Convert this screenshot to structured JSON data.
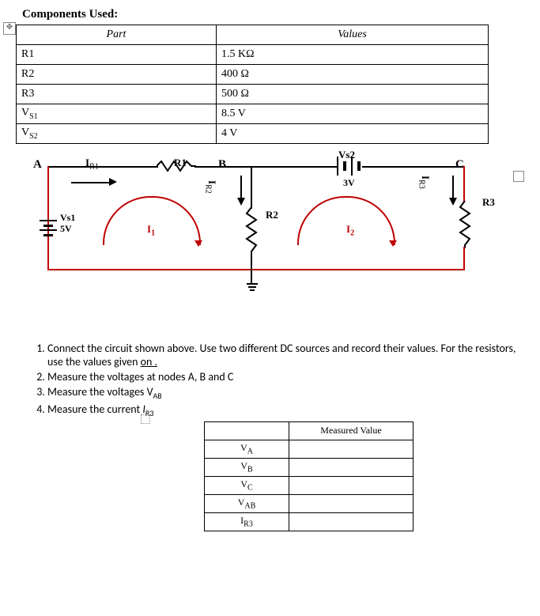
{
  "title": "Components Used:",
  "componentsTable": {
    "headers": {
      "part": "Part",
      "values": "Values"
    },
    "rows": [
      {
        "part": "R1",
        "value": "1.5 KΩ"
      },
      {
        "part": "R2",
        "value": "400 Ω"
      },
      {
        "part": "R3",
        "value": "500 Ω"
      },
      {
        "part": "Vs1",
        "partPrefix": "V",
        "partSub": "S1",
        "value": "8.5 V"
      },
      {
        "part": "Vs2",
        "partPrefix": "V",
        "partSub": "S2",
        "value": "4 V"
      }
    ]
  },
  "circuit": {
    "nodes": {
      "A": "A",
      "B": "B",
      "C": "C"
    },
    "labels": {
      "IR1": "I",
      "IR1sub": "R1",
      "R1": "R1",
      "IR2": "I",
      "IR2sub": "R2",
      "R2": "R2",
      "Vs2": "Vs2",
      "Vs2val": "3V",
      "IR3": "I",
      "IR3sub": "R3",
      "R3": "R3",
      "Vs1line1": "Vs1",
      "Vs1line2": "5V",
      "I1": "I",
      "I1sub": "1",
      "I2": "I",
      "I2sub": "2"
    }
  },
  "instructions": {
    "item1a": "Connect the circuit shown above. Use two different DC sources and record their values. For the resistors, use the values given ",
    "item1link": "on .",
    "item2": "Measure the voltages at nodes A, B and C",
    "item3a": "Measure the voltages V",
    "item3sub": "AB",
    "item4a": "Measure the current ",
    "item4cur": "I",
    "item4sub": "R3"
  },
  "measuredTable": {
    "header": "Measured Value",
    "rows": [
      {
        "main": "V",
        "sub": "A"
      },
      {
        "main": "V",
        "sub": "B"
      },
      {
        "main": "V",
        "sub": "C"
      },
      {
        "main": "V",
        "sub": "AB"
      },
      {
        "main": "I",
        "sub": "R3"
      }
    ]
  }
}
